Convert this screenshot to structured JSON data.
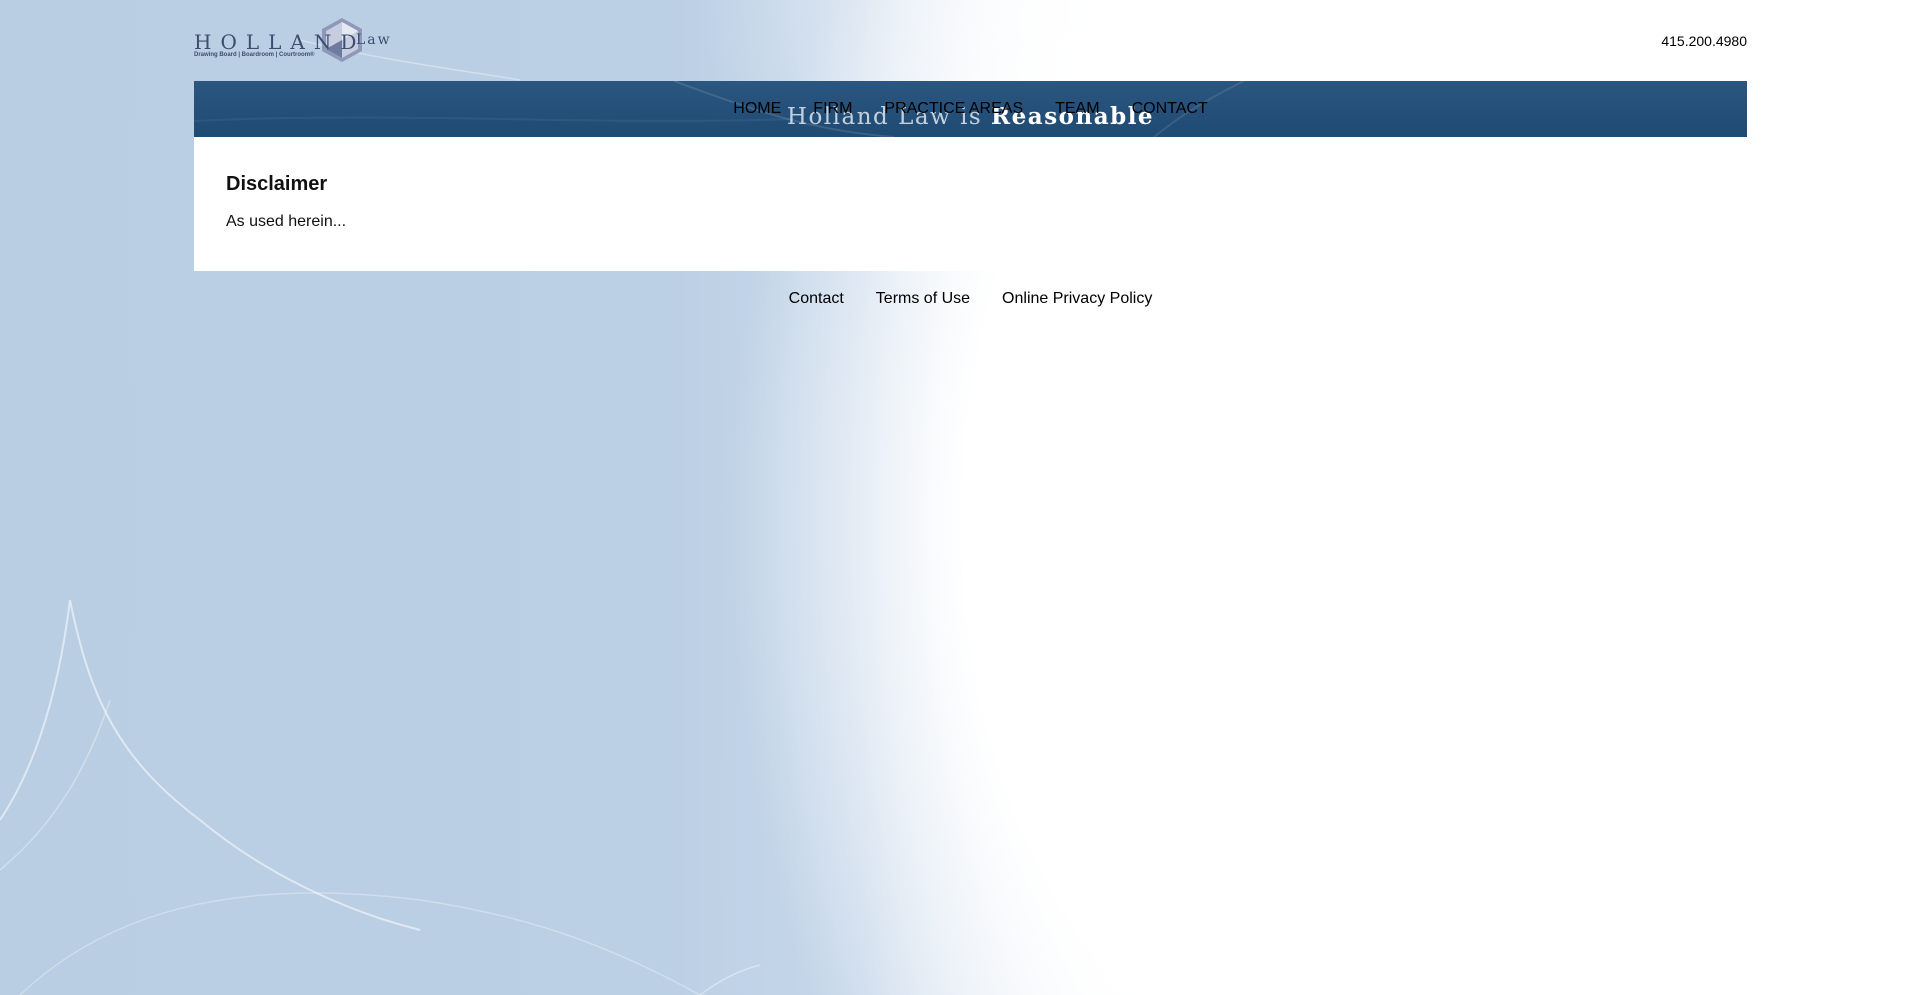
{
  "header": {
    "logo": {
      "word": "HOLLAND",
      "suffix": "Law",
      "tagline": "Drawing Board | Boardroom | Courtroom®"
    },
    "phone": "415.200.4980"
  },
  "banner": {
    "tagline_lead": "Holland Law is",
    "tagline_strong": "Reasonable"
  },
  "nav": {
    "items": [
      {
        "label": "HOME"
      },
      {
        "label": "FIRM"
      },
      {
        "label": "PRACTICE AREAS"
      },
      {
        "label": "TEAM"
      },
      {
        "label": "CONTACT"
      }
    ]
  },
  "main": {
    "title": "Disclaimer",
    "body": "As used herein..."
  },
  "footer": {
    "links": [
      {
        "label": "Contact"
      },
      {
        "label": "Terms of Use"
      },
      {
        "label": "Online Privacy Policy"
      }
    ]
  },
  "colors": {
    "nav_bar": "#234f78",
    "background_blue": "#b9cde3",
    "content_bg": "#ffffff"
  }
}
